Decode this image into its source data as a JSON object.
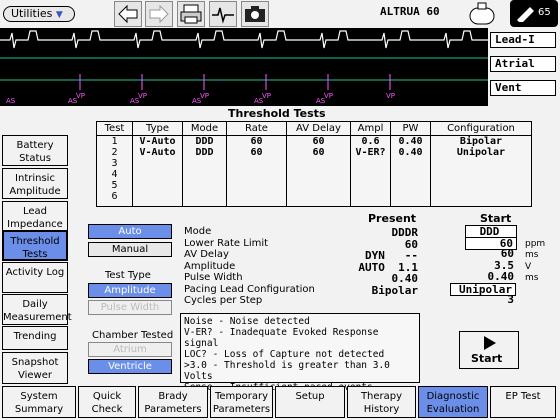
{
  "toolbar": {
    "menu_label": "Utilities",
    "device_name": "ALTRUA 60",
    "icons": [
      "back-arrow-icon",
      "forward-arrow-icon",
      "printer-icon",
      "ecg-wave-icon",
      "camera-icon"
    ],
    "battery_icon": "device-icon",
    "telemetry_value": "65"
  },
  "leads": {
    "lead1": "Lead-I",
    "atrial": "Atrial",
    "vent": "Vent"
  },
  "ecg_markers": [
    "AS",
    "VP",
    "AS",
    "VP",
    "AS",
    "VP",
    "AS",
    "VP",
    "AS",
    "VP",
    "AS",
    "VP"
  ],
  "panel": {
    "title": "Threshold Tests"
  },
  "table": {
    "headers": [
      "Test",
      "Type",
      "Mode",
      "Rate",
      "AV Delay",
      "Ampl",
      "PW",
      "Configuration"
    ],
    "rows": [
      [
        "1",
        "V-Auto",
        "DDD",
        "60",
        "60",
        "0.6",
        "0.40",
        "Bipolar"
      ],
      [
        "2",
        "V-Auto",
        "DDD",
        "60",
        "60",
        "V-ER?",
        "0.40",
        "Unipolar"
      ],
      [
        "3",
        "",
        "",
        "",
        "",
        "",
        "",
        ""
      ],
      [
        "4",
        "",
        "",
        "",
        "",
        "",
        "",
        ""
      ],
      [
        "5",
        "",
        "",
        "",
        "",
        "",
        "",
        ""
      ],
      [
        "6",
        "",
        "",
        "",
        "",
        "",
        "",
        ""
      ]
    ]
  },
  "left_nav": [
    {
      "label": "Battery Status"
    },
    {
      "label": "Intrinsic Amplitude"
    },
    {
      "label": "Lead Impedance"
    },
    {
      "label": "Threshold Tests",
      "selected": true
    },
    {
      "label": "Activity Log"
    },
    {
      "label": "Daily Measurement"
    },
    {
      "label": "Trending"
    },
    {
      "label": "Snapshot Viewer"
    }
  ],
  "controls": {
    "auto": "Auto",
    "manual": "Manual",
    "test_type_label": "Test Type",
    "amplitude": "Amplitude",
    "pulse_width": "Pulse Width",
    "chamber_label": "Chamber Tested",
    "atrium": "Atrium",
    "ventricle": "Ventricle"
  },
  "params": {
    "present_header": "Present",
    "start_header": "Start",
    "rows": [
      {
        "name": "Mode",
        "present": "DDDR",
        "start": "DDD",
        "unit": ""
      },
      {
        "name": "Lower Rate Limit",
        "present": "60",
        "start": "60",
        "unit": "ppm"
      },
      {
        "name": "AV Delay",
        "present": "DYN   --",
        "start": "60",
        "unit": "ms"
      },
      {
        "name": "Amplitude",
        "present": "AUTO  1.1",
        "start": "3.5",
        "unit": "V"
      },
      {
        "name": "Pulse Width",
        "present": "0.40",
        "start": "0.40",
        "unit": "ms"
      },
      {
        "name": "Pacing Lead Configuration",
        "present": "Bipolar",
        "start": "Unipolar",
        "unit": ""
      },
      {
        "name": "Cycles per Step",
        "present": "",
        "start": "3",
        "unit": ""
      }
    ]
  },
  "legend": [
    "Noise - Noise detected",
    "V-ER? - Inadequate Evoked Response signal",
    "LOC? - Loss of Capture not detected",
    ">3.0 - Threshold is greater than 3.0 Volts",
    "Sense - Insufficient paced events"
  ],
  "start_button": "Start",
  "bottom_nav": [
    {
      "label": "System Summary"
    },
    {
      "label": "Quick Check"
    },
    {
      "label": "Brady Parameters"
    },
    {
      "label": "Temporary Parameters"
    },
    {
      "label": "Setup"
    },
    {
      "label": "Therapy History"
    },
    {
      "label": "Diagnostic Evaluation",
      "selected": true
    },
    {
      "label": "EP Test"
    }
  ],
  "colors": {
    "accent": "#6b8ee8",
    "ecg_bg": "#000000",
    "ecg_trace": "#ffffff",
    "marker": "#ff55ff",
    "lead": "#20c0a0"
  }
}
